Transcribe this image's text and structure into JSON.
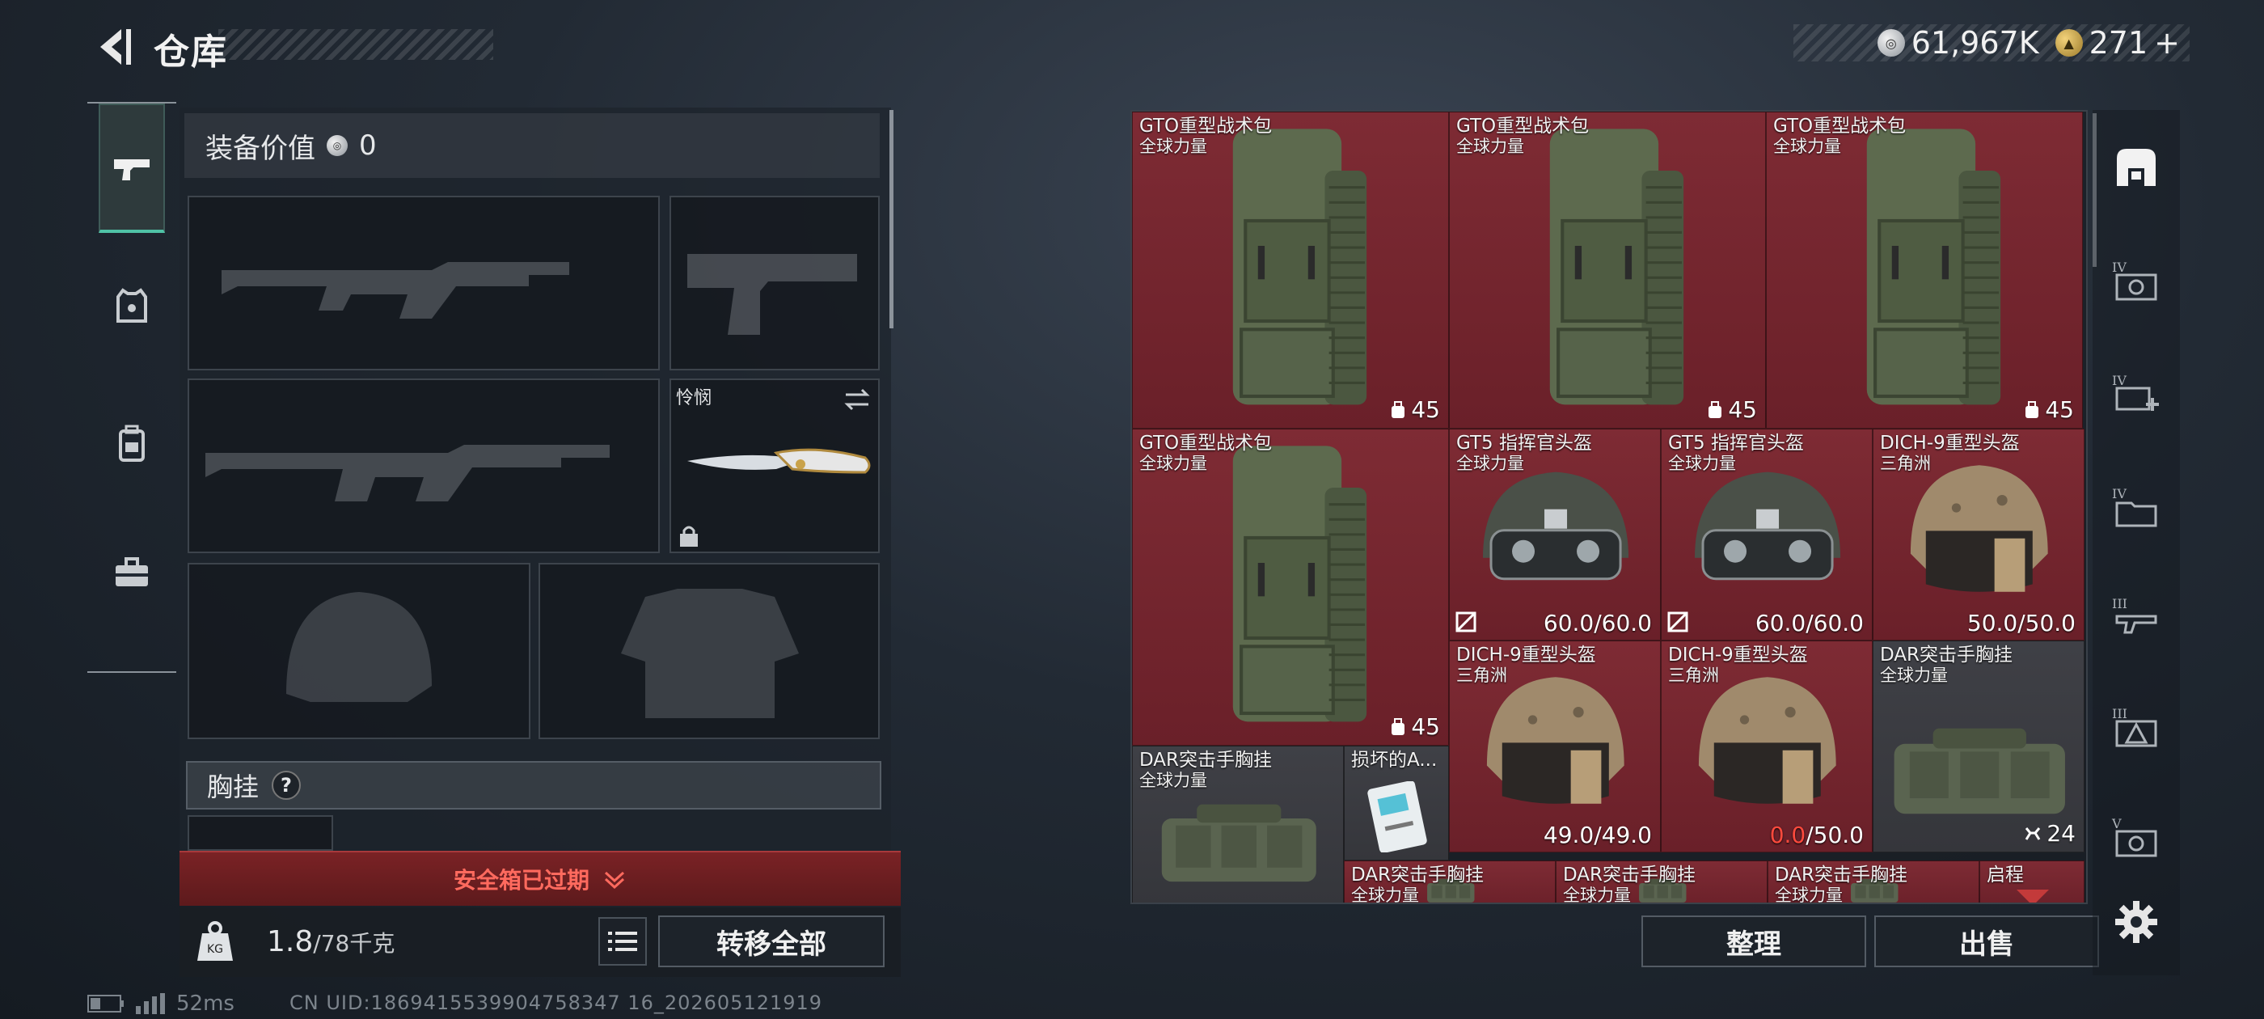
{
  "header": {
    "title": "仓库",
    "currency_silver": "61,967K",
    "currency_gold": "271",
    "gold_add": "+"
  },
  "left_nav": {
    "items": [
      {
        "name": "weapons",
        "icon": "pistol-icon",
        "active": true
      },
      {
        "name": "armor",
        "icon": "armor-vest-icon",
        "active": false
      },
      {
        "name": "backpack",
        "icon": "backpack-icon",
        "active": false
      },
      {
        "name": "toolbox",
        "icon": "toolbox-icon",
        "active": false
      }
    ]
  },
  "equipment": {
    "value_label": "装备价值",
    "value": "0",
    "melee_name": "怜悯",
    "chest_rig_label": "胸挂",
    "help": "?"
  },
  "safebox": {
    "expired_text": "安全箱已过期"
  },
  "footer": {
    "weight_current": "1.8",
    "weight_max": "/78千克",
    "kg_label": "KG",
    "transfer_all": "转移全部",
    "organize": "整理",
    "sell": "出售"
  },
  "status": {
    "ping": "52ms",
    "uid": "CN UID:1869415539904758347 16_202605121919"
  },
  "items": [
    {
      "name": "GTO重型战术包",
      "source": "全球力量",
      "qty": "45",
      "type": "backpack",
      "bg": "red"
    },
    {
      "name": "GTO重型战术包",
      "source": "全球力量",
      "qty": "45",
      "type": "backpack",
      "bg": "red"
    },
    {
      "name": "GTO重型战术包",
      "source": "全球力量",
      "qty": "45",
      "type": "backpack",
      "bg": "red"
    },
    {
      "name": "GTO重型战术包",
      "source": "全球力量",
      "qty": "45",
      "type": "backpack",
      "bg": "red"
    },
    {
      "name": "GT5 指挥官头盔",
      "source": "全球力量",
      "durability": "60.0/60.0",
      "type": "helmet-gt5",
      "bg": "red"
    },
    {
      "name": "GT5 指挥官头盔",
      "source": "全球力量",
      "durability": "60.0/60.0",
      "type": "helmet-gt5",
      "bg": "red"
    },
    {
      "name": "DICH-9重型头盔",
      "source": "三角洲",
      "durability": "50.0/50.0",
      "type": "helmet-dich",
      "bg": "red"
    },
    {
      "name": "DICH-9重型头盔",
      "source": "三角洲",
      "durability": "49.0/49.0",
      "type": "helmet-dich",
      "bg": "red"
    },
    {
      "name": "DICH-9重型头盔",
      "source": "三角洲",
      "durability_bad": "0.0",
      "durability_max": "/50.0",
      "type": "helmet-dich",
      "bg": "red"
    },
    {
      "name": "DAR突击手胸挂",
      "source": "全球力量",
      "qty": "24",
      "type": "rig",
      "bg": "grey"
    },
    {
      "name": "DAR突击手胸挂",
      "source": "全球力量",
      "type": "rig",
      "bg": "grey"
    },
    {
      "name": "损坏的A...",
      "type": "card",
      "bg": "grey"
    },
    {
      "name": "DAR突击手胸挂",
      "source": "全球力量",
      "type": "rig",
      "bg": "red"
    },
    {
      "name": "DAR突击手胸挂",
      "source": "全球力量",
      "type": "rig",
      "bg": "red"
    },
    {
      "name": "DAR突击手胸挂",
      "source": "全球力量",
      "type": "rig",
      "bg": "red"
    },
    {
      "name": "启程",
      "type": "misc",
      "bg": "red"
    }
  ],
  "right_nav": {
    "items": [
      "storage-home-icon",
      "tier4-case-icon",
      "tier4-medkit-icon",
      "tier4-folder-icon",
      "tier3-gun-icon",
      "tier3-triangle-icon",
      "tier5-case-icon",
      "settings-gear-icon"
    ]
  }
}
